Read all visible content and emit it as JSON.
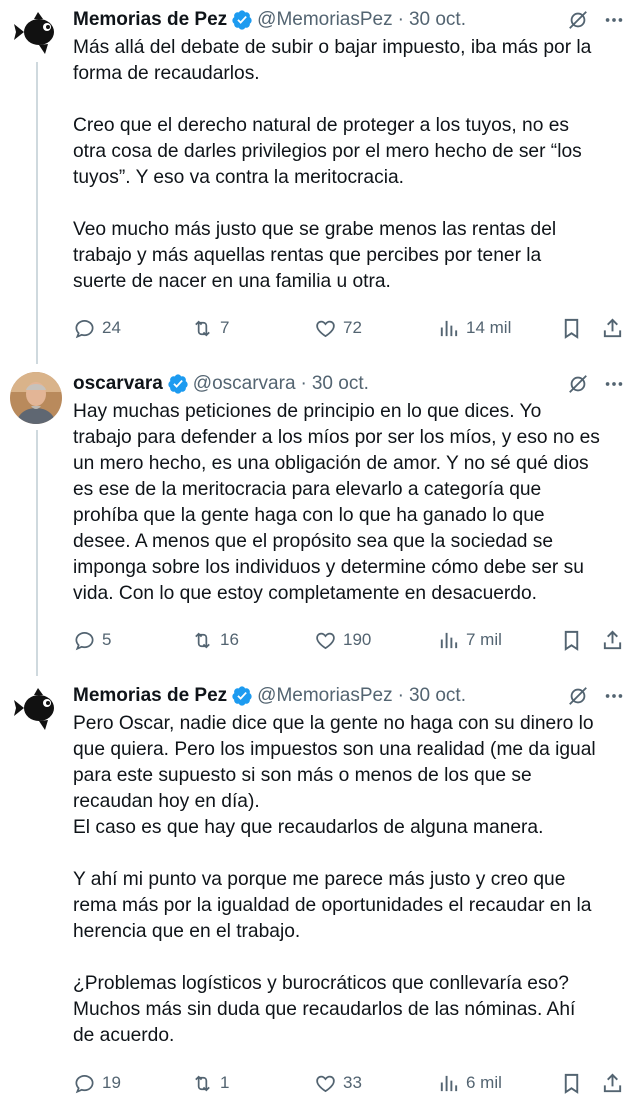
{
  "tweets": [
    {
      "avatar": "fish-silhouette",
      "name": "Memorias de Pez",
      "handle": "@MemoriasPez",
      "date": "30 oct.",
      "lines": [
        "Más allá del debate de subir o bajar impuesto, iba más por la",
        "forma de recaudarlos.",
        "",
        "Creo que el derecho natural de proteger a los tuyos, no es",
        "otra cosa de darles privilegios por el mero hecho de ser “los",
        "tuyos”. Y eso va contra la meritocracia.",
        "",
        "Veo mucho más justo que se grabe menos las rentas del",
        "trabajo y más aquellas rentas que percibes por tener la",
        "suerte de nacer en una familia u otra."
      ],
      "replies": "24",
      "reposts": "7",
      "likes": "72",
      "views": "14 mil"
    },
    {
      "avatar": "man-photo",
      "name": "oscarvara",
      "handle": "@oscarvara",
      "date": "30 oct.",
      "lines": [
        "Hay muchas peticiones de principio en lo que dices. Yo",
        "trabajo para defender a los míos por ser los míos, y eso no es",
        "un mero hecho, es una obligación de amor. Y no sé qué dios",
        "es ese de la meritocracia para elevarlo a categoría que",
        "prohíba que la gente haga con lo que ha ganado lo que",
        "desee. A menos que el propósito sea que la sociedad se",
        "imponga sobre los individuos y determine cómo debe ser su",
        "vida. Con lo que estoy completamente en desacuerdo."
      ],
      "replies": "5",
      "reposts": "16",
      "likes": "190",
      "views": "7 mil"
    },
    {
      "avatar": "fish-silhouette",
      "name": "Memorias de Pez",
      "handle": "@MemoriasPez",
      "date": "30 oct.",
      "lines": [
        "Pero Oscar, nadie dice que la gente no haga con su dinero lo",
        "que quiera. Pero los impuestos son una realidad (me da igual",
        "para este supuesto si son más o menos de los que se",
        "recaudan hoy en día).",
        "El caso es que hay que recaudarlos de alguna manera.",
        "",
        "Y ahí mi punto va porque me parece más justo y creo que",
        "rema más por la igualdad de oportunidades el recaudar en la",
        "herencia que en el trabajo.",
        "",
        "¿Problemas logísticos y burocráticos que conllevaría eso?",
        "Muchos más sin duda que recaudarlos de las nóminas. Ahí",
        "de acuerdo."
      ],
      "replies": "19",
      "reposts": "1",
      "likes": "33",
      "views": "6 mil"
    }
  ],
  "colors": {
    "text": "#0f1419",
    "secondary": "#536471",
    "verified": "#1d9bf0",
    "thread_line": "#cfd9de"
  },
  "icons": [
    "verified-badge-icon",
    "grok-icon",
    "more-icon",
    "reply-icon",
    "repost-icon",
    "like-icon",
    "views-icon",
    "bookmark-icon",
    "share-icon"
  ]
}
